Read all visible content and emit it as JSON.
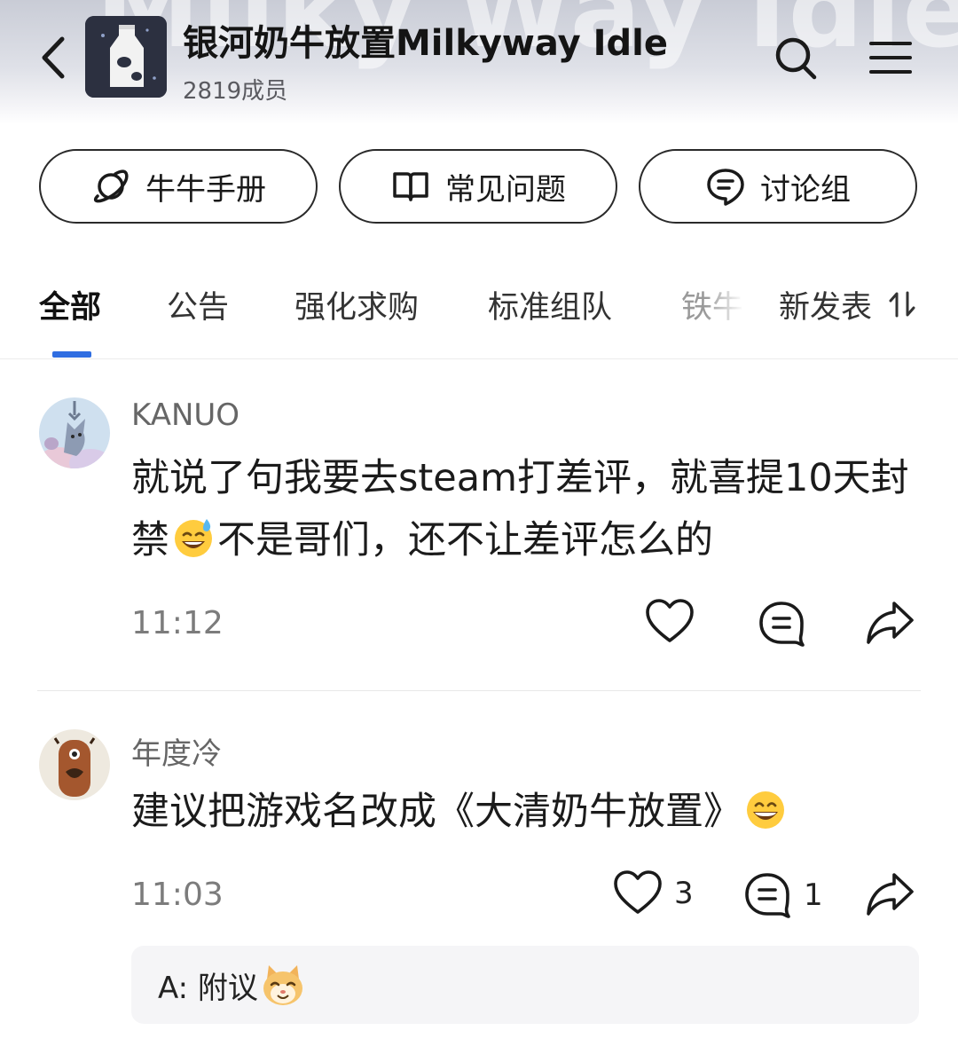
{
  "header": {
    "title": "银河奶牛放置Milkyway Idle",
    "members": "2819成员",
    "banner_text": "Milky Way Idle"
  },
  "quick_links": [
    {
      "label": "牛牛手册",
      "icon": "planet-icon"
    },
    {
      "label": "常见问题",
      "icon": "book-icon"
    },
    {
      "label": "讨论组",
      "icon": "chat-bubble-icon"
    }
  ],
  "tabs": {
    "items": [
      "全部",
      "公告",
      "强化求购",
      "标准组队",
      "铁牛"
    ],
    "active": "全部",
    "sort_label": "新发表"
  },
  "posts": [
    {
      "author": "KANUO",
      "text_before": "就说了句我要去steam打差评，就喜提10天封禁",
      "emoji": "sweat-smile-emoji",
      "text_after": "不是哥们，还不让差评怎么的",
      "time": "11:12",
      "likes": "",
      "comments": ""
    },
    {
      "author": "年度冷",
      "text_before": "建议把游戏名改成《大清奶牛放置》",
      "emoji": "grin-emoji",
      "text_after": "",
      "time": "11:03",
      "likes": "3",
      "comments": "1",
      "reply": {
        "prefix": "A: 附议",
        "emoji": "cat-face-emoji"
      }
    }
  ],
  "colors": {
    "accent": "#2f6de1",
    "border": "#2a2a2a",
    "muted": "#7c7c7c"
  }
}
